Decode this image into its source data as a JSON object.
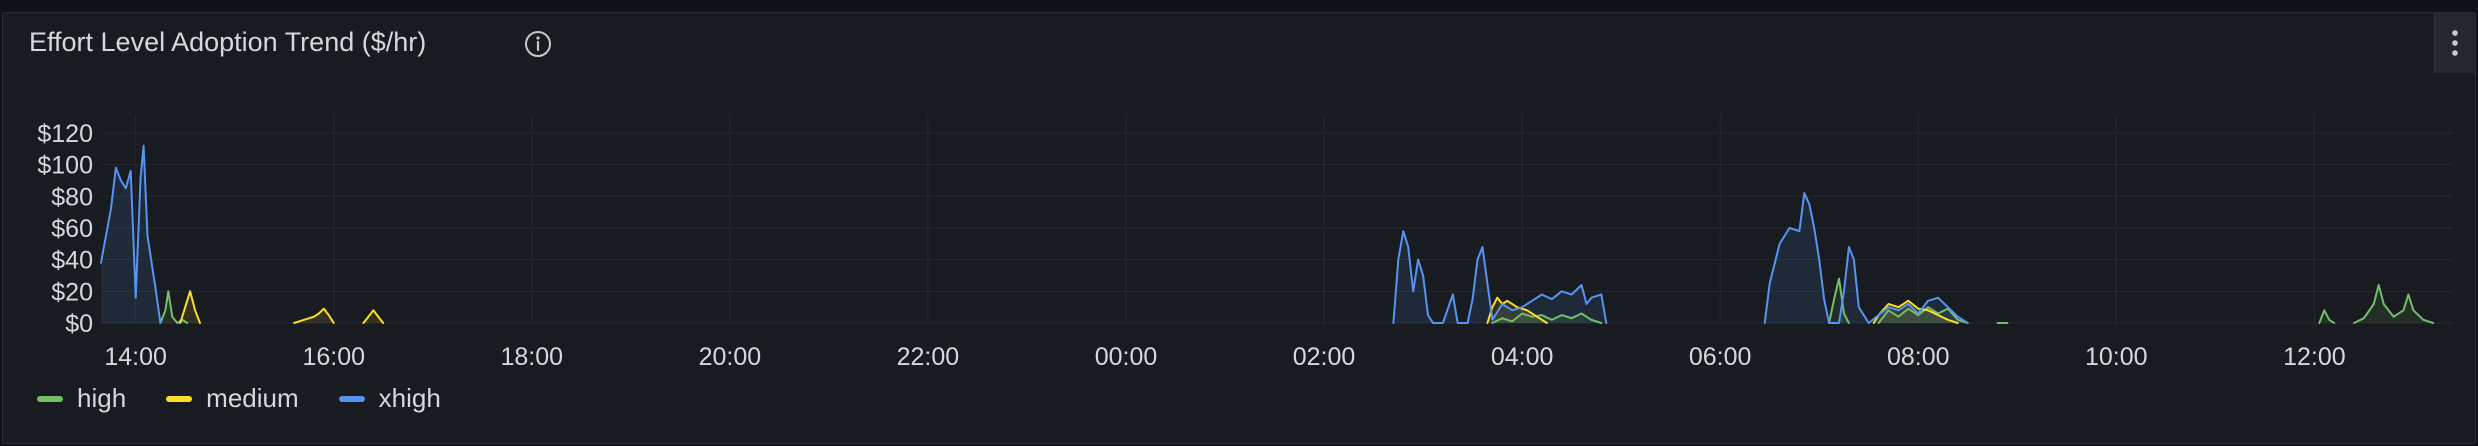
{
  "panel": {
    "title": "Effort Level Adoption Trend ($/hr)",
    "info_icon": "info-circle-icon",
    "menu_icon": "vertical-dots-icon"
  },
  "chart_data": {
    "type": "line",
    "title": "Effort Level Adoption Trend ($/hr)",
    "xlabel": "",
    "ylabel": "",
    "ylim": [
      0,
      125
    ],
    "xlim_hours": [
      13.65,
      37.4
    ],
    "yticks": [
      0,
      20,
      40,
      60,
      80,
      100,
      120
    ],
    "ytick_labels": [
      "$0",
      "$20",
      "$40",
      "$60",
      "$80",
      "$100",
      "$120"
    ],
    "xtick_labels": [
      "14:00",
      "16:00",
      "18:00",
      "20:00",
      "22:00",
      "00:00",
      "02:00",
      "04:00",
      "06:00",
      "08:00",
      "10:00",
      "12:00"
    ],
    "xtick_hours": [
      14,
      16,
      18,
      20,
      22,
      24,
      26,
      28,
      30,
      32,
      34,
      36
    ],
    "grid": true,
    "legend_position": "bottom-left",
    "series": [
      {
        "name": "high",
        "color": "#73bf69",
        "segments": [
          [
            [
              14.25,
              0
            ],
            [
              14.3,
              8
            ],
            [
              14.33,
              20
            ],
            [
              14.37,
              4
            ],
            [
              14.42,
              0
            ],
            [
              14.47,
              2
            ],
            [
              14.52,
              0
            ]
          ],
          [
            [
              27.7,
              0
            ],
            [
              27.8,
              3
            ],
            [
              27.9,
              1
            ],
            [
              28.0,
              6
            ],
            [
              28.1,
              4
            ],
            [
              28.2,
              5
            ],
            [
              28.3,
              2
            ],
            [
              28.4,
              5
            ],
            [
              28.5,
              3
            ],
            [
              28.6,
              6
            ],
            [
              28.7,
              2
            ],
            [
              28.8,
              0
            ]
          ],
          [
            [
              31.1,
              0
            ],
            [
              31.15,
              15
            ],
            [
              31.2,
              28
            ],
            [
              31.25,
              6
            ],
            [
              31.3,
              0
            ]
          ],
          [
            [
              31.6,
              0
            ],
            [
              31.7,
              8
            ],
            [
              31.8,
              4
            ],
            [
              31.9,
              9
            ],
            [
              32.0,
              5
            ],
            [
              32.1,
              10
            ],
            [
              32.2,
              6
            ],
            [
              32.3,
              9
            ],
            [
              32.4,
              2
            ],
            [
              32.5,
              0
            ]
          ],
          [
            [
              32.8,
              0
            ],
            [
              32.9,
              0
            ]
          ],
          [
            [
              36.05,
              0
            ],
            [
              36.1,
              8
            ],
            [
              36.15,
              2
            ],
            [
              36.2,
              0
            ]
          ],
          [
            [
              36.4,
              0
            ],
            [
              36.5,
              3
            ],
            [
              36.6,
              12
            ],
            [
              36.65,
              24
            ],
            [
              36.7,
              12
            ],
            [
              36.8,
              4
            ],
            [
              36.9,
              8
            ],
            [
              36.95,
              18
            ],
            [
              37.0,
              8
            ],
            [
              37.1,
              2
            ],
            [
              37.2,
              0
            ]
          ]
        ]
      },
      {
        "name": "medium",
        "color": "#fade2a",
        "segments": [
          [
            [
              14.45,
              0
            ],
            [
              14.5,
              10
            ],
            [
              14.55,
              20
            ],
            [
              14.6,
              8
            ],
            [
              14.65,
              0
            ]
          ],
          [
            [
              15.6,
              0
            ],
            [
              15.7,
              2
            ],
            [
              15.8,
              4
            ],
            [
              15.85,
              6
            ],
            [
              15.9,
              9
            ],
            [
              15.95,
              5
            ],
            [
              16.0,
              0
            ]
          ],
          [
            [
              16.3,
              0
            ],
            [
              16.35,
              4
            ],
            [
              16.4,
              8
            ],
            [
              16.45,
              4
            ],
            [
              16.5,
              0
            ]
          ],
          [
            [
              27.65,
              0
            ],
            [
              27.7,
              10
            ],
            [
              27.75,
              16
            ],
            [
              27.8,
              12
            ],
            [
              27.85,
              14
            ],
            [
              27.95,
              10
            ],
            [
              28.05,
              8
            ],
            [
              28.15,
              4
            ],
            [
              28.25,
              0
            ]
          ],
          [
            [
              31.55,
              0
            ],
            [
              31.6,
              5
            ],
            [
              31.7,
              12
            ],
            [
              31.8,
              10
            ],
            [
              31.9,
              14
            ],
            [
              32.0,
              9
            ],
            [
              32.1,
              8
            ],
            [
              32.2,
              5
            ],
            [
              32.3,
              2
            ],
            [
              32.4,
              0
            ]
          ]
        ]
      },
      {
        "name": "xhigh",
        "color": "#5794f2",
        "segments": [
          [
            [
              13.65,
              38
            ],
            [
              13.75,
              72
            ],
            [
              13.8,
              98
            ],
            [
              13.85,
              90
            ],
            [
              13.9,
              85
            ],
            [
              13.95,
              96
            ],
            [
              14.0,
              16
            ],
            [
              14.05,
              92
            ],
            [
              14.08,
              112
            ],
            [
              14.12,
              55
            ],
            [
              14.2,
              22
            ],
            [
              14.25,
              0
            ]
          ],
          [
            [
              26.7,
              0
            ],
            [
              26.75,
              40
            ],
            [
              26.8,
              58
            ],
            [
              26.85,
              48
            ],
            [
              26.9,
              20
            ],
            [
              26.95,
              40
            ],
            [
              27.0,
              30
            ],
            [
              27.05,
              5
            ],
            [
              27.1,
              0
            ],
            [
              27.2,
              0
            ],
            [
              27.3,
              18
            ],
            [
              27.35,
              0
            ],
            [
              27.45,
              0
            ],
            [
              27.5,
              15
            ],
            [
              27.55,
              40
            ],
            [
              27.6,
              48
            ],
            [
              27.65,
              25
            ],
            [
              27.7,
              2
            ],
            [
              27.8,
              12
            ],
            [
              27.9,
              8
            ],
            [
              28.0,
              10
            ],
            [
              28.1,
              14
            ],
            [
              28.2,
              18
            ],
            [
              28.3,
              15
            ],
            [
              28.4,
              20
            ],
            [
              28.5,
              18
            ],
            [
              28.6,
              24
            ],
            [
              28.65,
              12
            ],
            [
              28.7,
              16
            ],
            [
              28.8,
              18
            ],
            [
              28.85,
              0
            ]
          ],
          [
            [
              30.45,
              0
            ],
            [
              30.5,
              25
            ],
            [
              30.6,
              50
            ],
            [
              30.7,
              60
            ],
            [
              30.8,
              58
            ],
            [
              30.85,
              82
            ],
            [
              30.9,
              75
            ],
            [
              30.95,
              60
            ],
            [
              31.0,
              40
            ],
            [
              31.05,
              15
            ],
            [
              31.1,
              0
            ],
            [
              31.2,
              0
            ],
            [
              31.25,
              20
            ],
            [
              31.3,
              48
            ],
            [
              31.35,
              40
            ],
            [
              31.4,
              10
            ],
            [
              31.5,
              0
            ],
            [
              31.6,
              5
            ],
            [
              31.7,
              10
            ],
            [
              31.8,
              8
            ],
            [
              31.9,
              12
            ],
            [
              32.0,
              6
            ],
            [
              32.1,
              14
            ],
            [
              32.2,
              16
            ],
            [
              32.3,
              10
            ],
            [
              32.4,
              4
            ],
            [
              32.5,
              0
            ]
          ]
        ]
      }
    ]
  }
}
